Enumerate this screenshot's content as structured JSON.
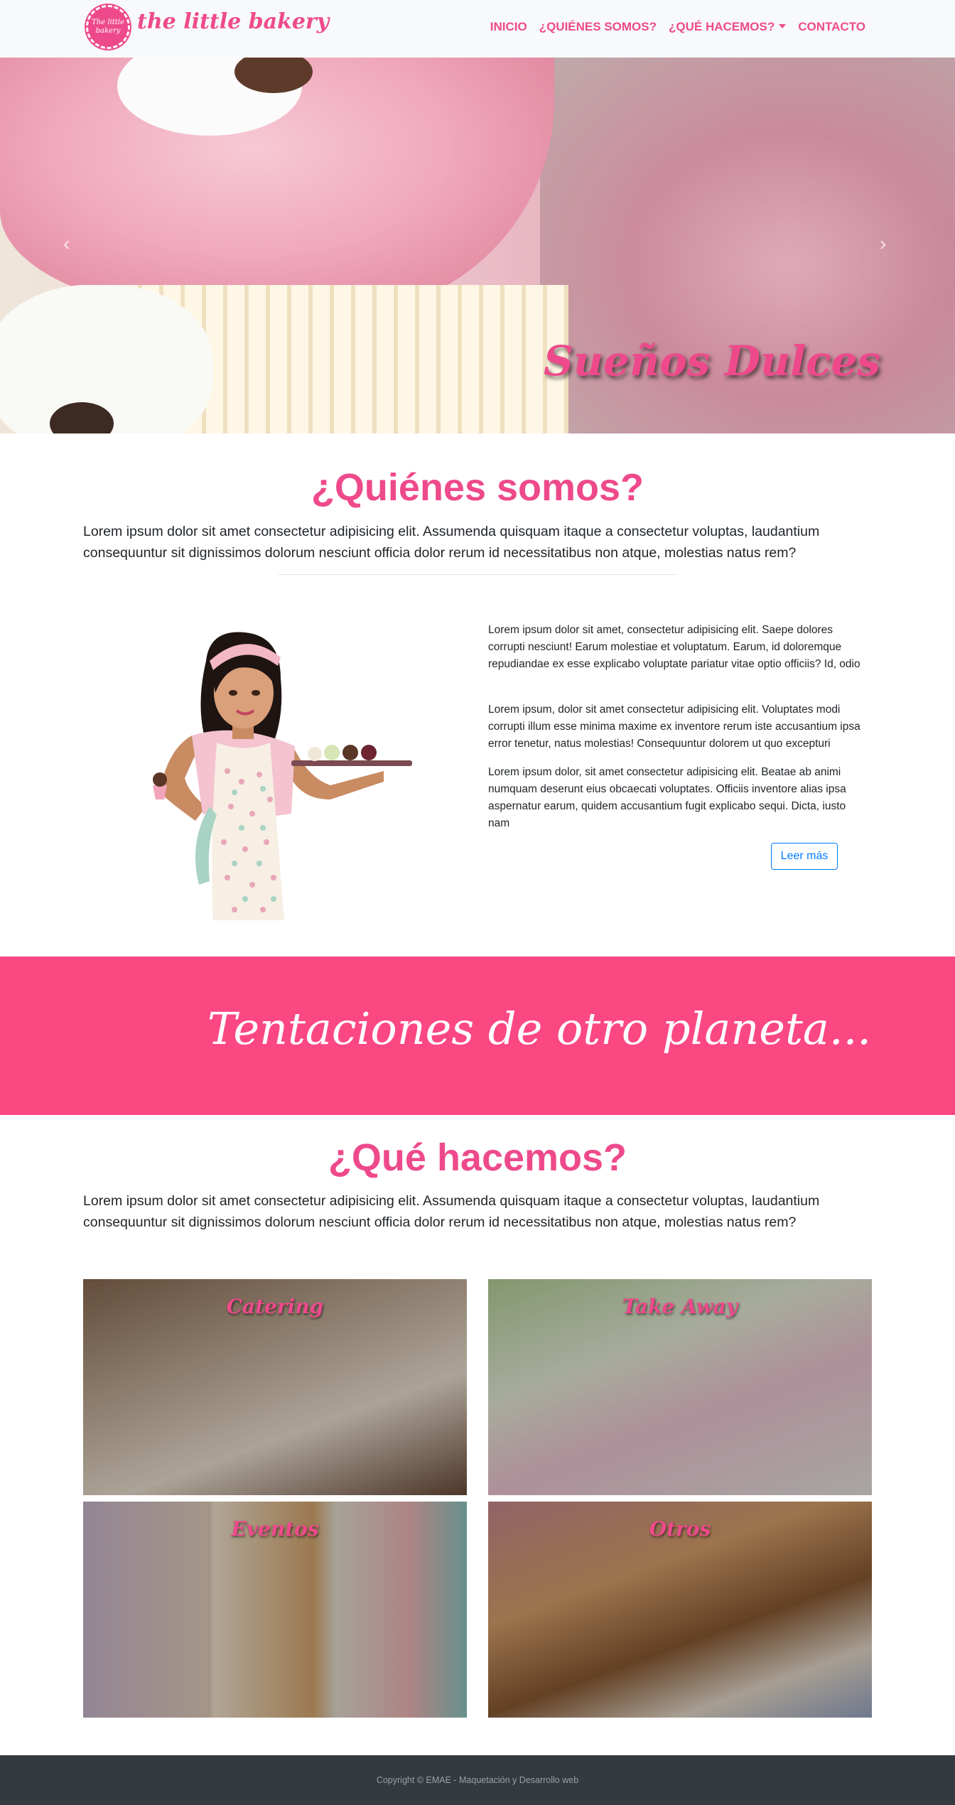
{
  "navbar": {
    "logo_badge": "The little bakery",
    "brand": "the little bakery",
    "items": [
      {
        "label": "INICIO"
      },
      {
        "label": "¿QUIÉNES SOMOS?"
      },
      {
        "label": "¿QUÉ HACEMOS?",
        "dropdown": true
      },
      {
        "label": "CONTACTO"
      }
    ]
  },
  "hero": {
    "caption": "Sueños Dulces",
    "prev_icon": "chevron-left-icon",
    "next_icon": "chevron-right-icon"
  },
  "quienes": {
    "title": "¿Quiénes somos?",
    "lead": "Lorem ipsum dolor sit amet consectetur adipisicing elit. Assumenda quisquam itaque a consectetur voluptas, laudantium consequuntur sit dignissimos dolorum nesciunt officia dolor rerum id necessitatibus non atque, molestias natus rem?",
    "paragraphs": [
      "Lorem ipsum dolor sit amet, consectetur adipisicing elit. Saepe dolores corrupti nesciunt! Earum molestiae et voluptatum. Earum, id doloremque repudiandae ex esse explicabo voluptate pariatur vitae optio officiis? Id, odio",
      "Lorem ipsum, dolor sit amet consectetur adipisicing elit. Voluptates modi corrupti illum esse minima maxime ex inventore rerum iste accusantium ipsa error tenetur, natus molestias! Consequuntur dolorem ut quo excepturi",
      "Lorem ipsum dolor, sit amet consectetur adipisicing elit. Beatae ab animi numquam deserunt eius obcaecati voluptates. Officiis inventore alias ipsa aspernatur earum, quidem accusantium fugit explicabo sequi. Dicta, iusto nam"
    ],
    "button": "Leer más"
  },
  "banner": {
    "text": "Tentaciones de otro planeta..."
  },
  "hacemos": {
    "title": "¿Qué hacemos?",
    "lead": "Lorem ipsum dolor sit amet consectetur adipisicing elit. Assumenda quisquam itaque a consectetur voluptas, laudantium consequuntur sit dignissimos dolorum nesciunt officia dolor rerum id necessitatibus non atque, molestias natus rem?",
    "cards": [
      {
        "title": "Catering"
      },
      {
        "title": "Take Away"
      },
      {
        "title": "Eventos"
      },
      {
        "title": "Otros"
      }
    ]
  },
  "footer": {
    "text": "Copyright © EMAE - Maquetación y Desarrollo web"
  },
  "colors": {
    "brand_pink": "#ee4a8b",
    "banner_pink": "#fb4883",
    "footer_bg": "#343a40",
    "button_blue": "#007bff"
  }
}
